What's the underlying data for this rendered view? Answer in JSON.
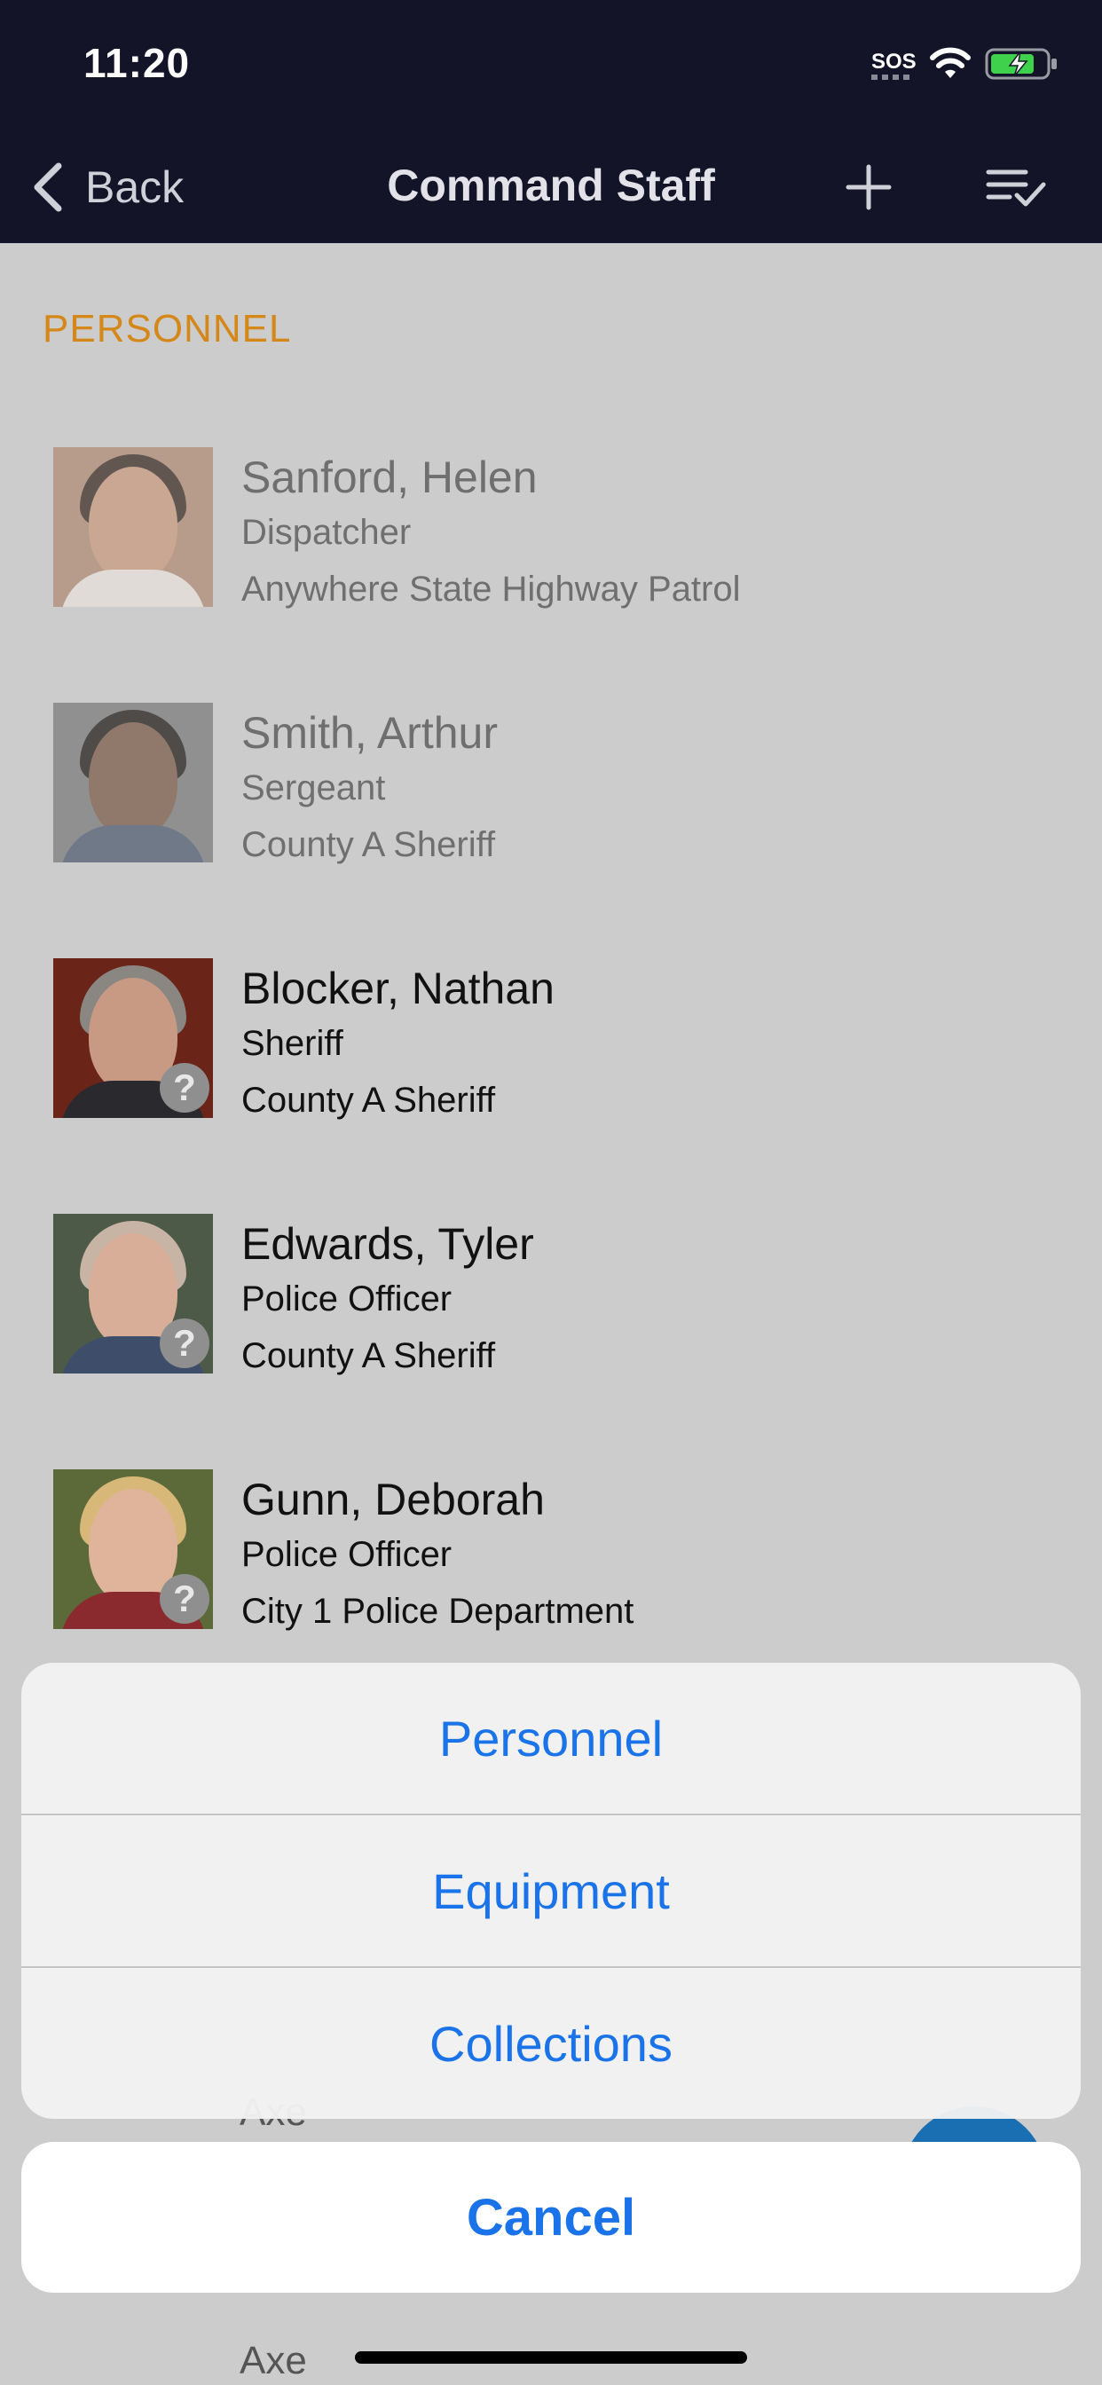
{
  "status_bar": {
    "time": "11:20",
    "sos": "SOS"
  },
  "nav": {
    "back_label": "Back",
    "title": "Command Staff"
  },
  "section": {
    "header": "PERSONNEL"
  },
  "personnel": [
    {
      "name": "Sanford, Helen",
      "title": "Dispatcher",
      "agency": "Anywhere State Highway Patrol"
    },
    {
      "name": "Smith, Arthur",
      "title": "Sergeant",
      "agency": "County A Sheriff"
    },
    {
      "name": "Blocker, Nathan",
      "title": "Sheriff",
      "agency": "County A Sheriff",
      "badge": "?"
    },
    {
      "name": "Edwards, Tyler",
      "title": "Police Officer",
      "agency": "County A Sheriff",
      "badge": "?"
    },
    {
      "name": "Gunn, Deborah",
      "title": "Police Officer",
      "agency": "City 1 Police Department",
      "badge": "?"
    }
  ],
  "hidden_peek": {
    "item_1": "Axe",
    "item_2": "Axe"
  },
  "action_sheet": {
    "options": [
      "Personnel",
      "Equipment",
      "Collections"
    ],
    "cancel_label": "Cancel"
  },
  "colors": {
    "accent": "#1a73e8",
    "section_header": "#d4881a",
    "nav_bg": "#141428"
  }
}
